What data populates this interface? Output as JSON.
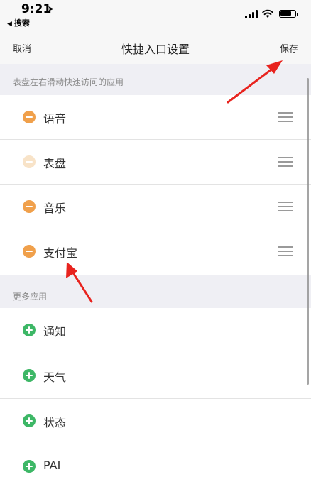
{
  "status_bar": {
    "time": "9:21",
    "location_icon": "location-arrow-icon",
    "back_app": "搜索",
    "icons": [
      "cellular-signal-icon",
      "wifi-icon",
      "battery-icon"
    ]
  },
  "nav": {
    "cancel": "取消",
    "title": "快捷入口设置",
    "save": "保存"
  },
  "sections": {
    "enabled_header": "表盘左右滑动快速访问的应用",
    "more_header": "更多应用"
  },
  "enabled_apps": [
    {
      "label": "语音"
    },
    {
      "label": "表盘"
    },
    {
      "label": "音乐"
    },
    {
      "label": "支付宝"
    }
  ],
  "more_apps": [
    {
      "label": "通知"
    },
    {
      "label": "天气"
    },
    {
      "label": "状态"
    },
    {
      "label": "PAI"
    }
  ],
  "colors": {
    "remove_badge": "#f0a04b",
    "remove_badge_disabled": "#f8e3c8",
    "add_badge": "#3db766",
    "annotation_arrow": "#e8231e"
  }
}
